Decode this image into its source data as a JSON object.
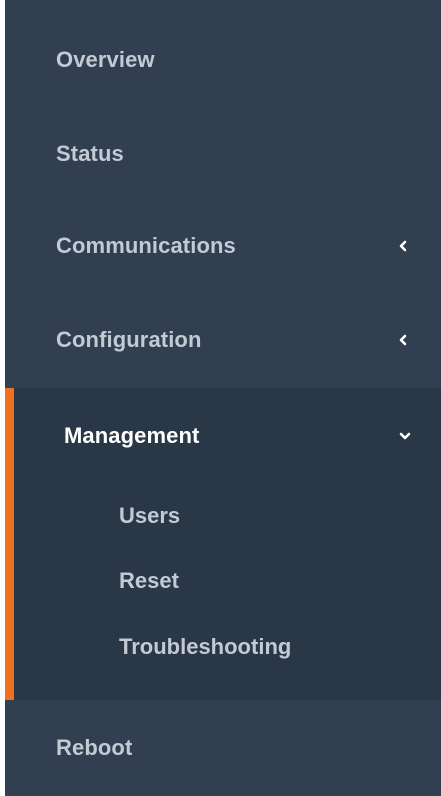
{
  "sidebar": {
    "items": [
      {
        "label": "Overview"
      },
      {
        "label": "Status"
      },
      {
        "label": "Communications",
        "icon": "chevron-left-icon"
      },
      {
        "label": "Configuration",
        "icon": "chevron-left-icon"
      }
    ],
    "active_group": {
      "label": "Management",
      "icon": "chevron-down-icon",
      "expanded": true,
      "children": [
        {
          "label": "Users"
        },
        {
          "label": "Reset"
        },
        {
          "label": "Troubleshooting"
        }
      ]
    },
    "bottom_item": {
      "label": "Reboot"
    }
  },
  "colors": {
    "sidebar_bg": "#313f51",
    "active_group_bg": "#2a3746",
    "accent": "#f07021",
    "text": "#c3cad4",
    "active_text": "#ffffff"
  }
}
